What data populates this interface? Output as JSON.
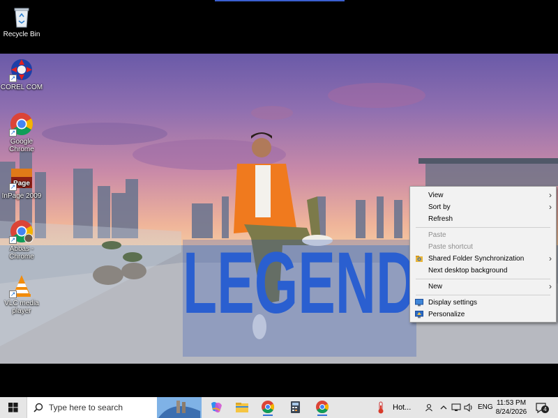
{
  "desktop_icons": [
    {
      "label": "Recycle Bin",
      "icon": "recycle-bin-icon"
    },
    {
      "label": "COREL COM",
      "icon": "corel-icon"
    },
    {
      "label": "Google Chrome",
      "icon": "chrome-icon"
    },
    {
      "label": "InPage 2009",
      "icon": "inpage-icon"
    },
    {
      "label": "Abbas - Chrome",
      "icon": "chrome-icon"
    },
    {
      "label": "VLC media player",
      "icon": "vlc-icon"
    }
  ],
  "wallpaper": {
    "sign_text": "LEGEND"
  },
  "context_menu": {
    "items": [
      {
        "label": "View",
        "submenu": true,
        "enabled": true
      },
      {
        "label": "Sort by",
        "submenu": true,
        "enabled": true
      },
      {
        "label": "Refresh",
        "submenu": false,
        "enabled": true
      },
      {
        "label": "Paste",
        "submenu": false,
        "enabled": false
      },
      {
        "label": "Paste shortcut",
        "submenu": false,
        "enabled": false
      },
      {
        "label": "Shared Folder Synchronization",
        "submenu": true,
        "enabled": true,
        "icon": "sync-folder-icon"
      },
      {
        "label": "Next desktop background",
        "submenu": false,
        "enabled": true
      },
      {
        "label": "New",
        "submenu": true,
        "enabled": true
      },
      {
        "label": "Display settings",
        "submenu": false,
        "enabled": true,
        "icon": "display-icon"
      },
      {
        "label": "Personalize",
        "submenu": false,
        "enabled": true,
        "icon": "personalize-icon"
      }
    ]
  },
  "taskbar": {
    "search_placeholder": "Type here to search",
    "weather_text": "Hot...",
    "language": "ENG",
    "time": "11:53 PM",
    "date": "8/24/2026",
    "notification_count": "4",
    "apps": [
      "copilot-icon",
      "file-explorer-icon",
      "chrome-icon",
      "calculator-icon",
      "chrome-icon"
    ]
  },
  "colors": {
    "accent": "#2f6fd6",
    "menu_bg": "#f2f2f2",
    "taskbar_bg": "#e6e6e6",
    "sign_blue": "#2a5fd0",
    "shirt_orange": "#f07a1e"
  }
}
